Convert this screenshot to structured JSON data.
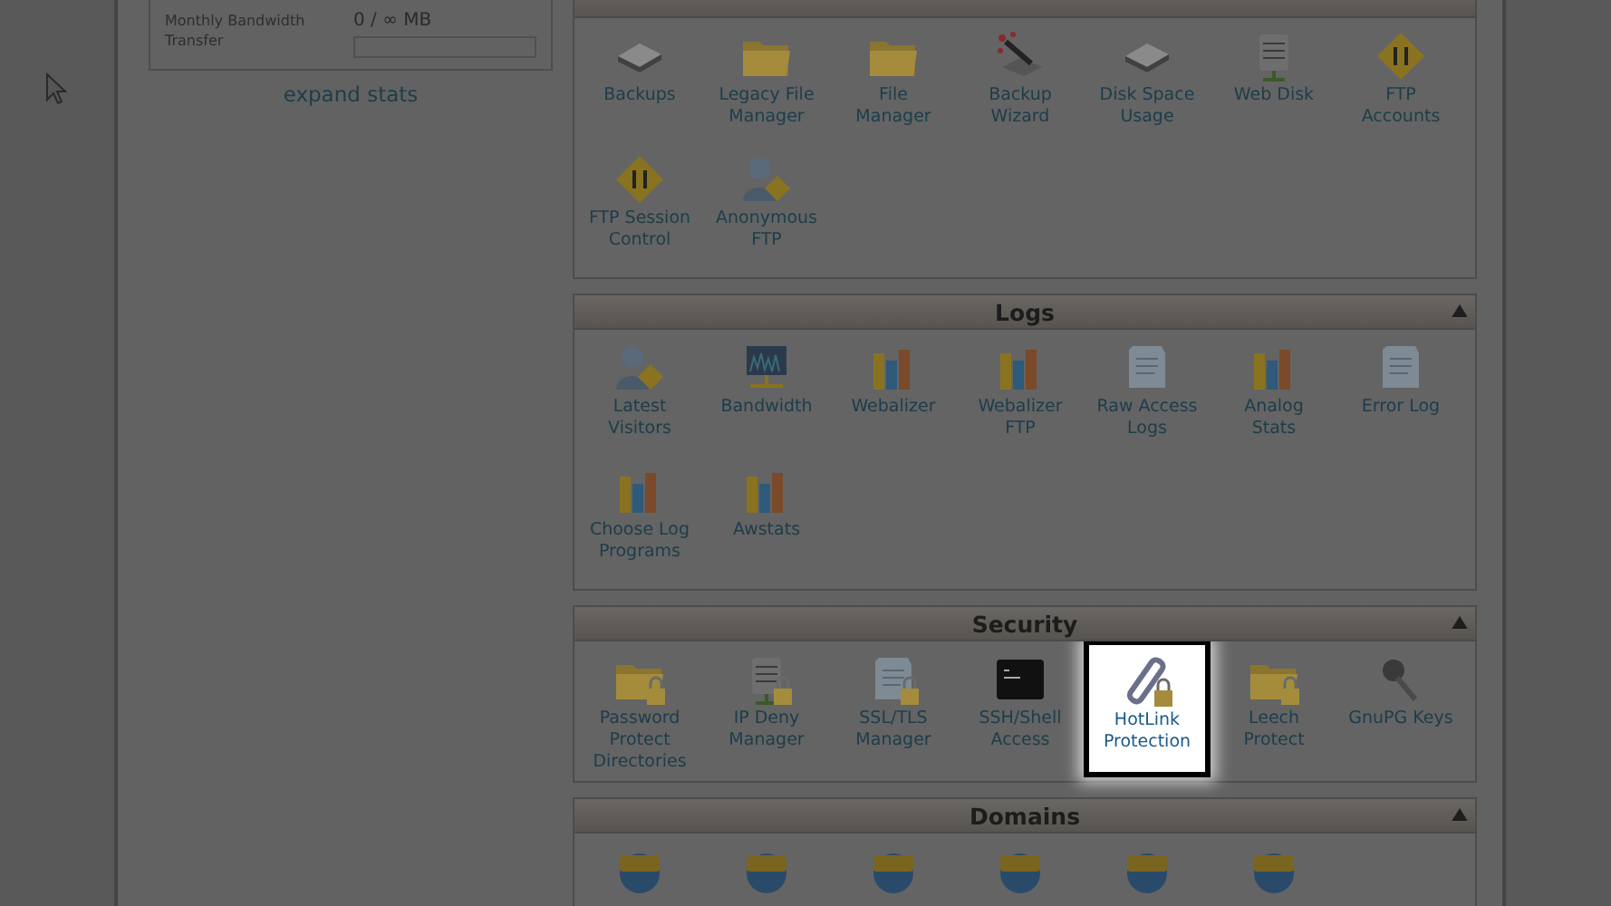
{
  "stats": {
    "label": "Monthly Bandwidth Transfer",
    "value": "0 / ∞ MB"
  },
  "expand_link": "expand stats",
  "sections": [
    {
      "items": [
        {
          "label": "Backups",
          "selected": false
        },
        {
          "label": "Legacy File Manager",
          "selected": false
        },
        {
          "label": "File Manager",
          "selected": false
        },
        {
          "label": "Backup Wizard",
          "selected": false
        },
        {
          "label": "Disk Space Usage",
          "selected": false
        },
        {
          "label": "Web Disk",
          "selected": false
        },
        {
          "label": "FTP Accounts",
          "selected": false
        },
        {
          "label": "FTP Session Control",
          "selected": false
        },
        {
          "label": "Anonymous FTP",
          "selected": false
        }
      ]
    },
    {
      "title": "Logs",
      "items": [
        {
          "label": "Latest Visitors",
          "selected": false
        },
        {
          "label": "Bandwidth",
          "selected": false
        },
        {
          "label": "Webalizer",
          "selected": false
        },
        {
          "label": "Webalizer FTP",
          "selected": false
        },
        {
          "label": "Raw Access Logs",
          "selected": false
        },
        {
          "label": "Analog Stats",
          "selected": false
        },
        {
          "label": "Error Log",
          "selected": false
        },
        {
          "label": "Choose Log Programs",
          "selected": false
        },
        {
          "label": "Awstats",
          "selected": false
        }
      ]
    },
    {
      "title": "Security",
      "items": [
        {
          "label": "Password Protect Directories",
          "selected": false
        },
        {
          "label": "IP Deny Manager",
          "selected": false
        },
        {
          "label": "SSL/TLS Manager",
          "selected": false
        },
        {
          "label": "SSH/Shell Access",
          "selected": false
        },
        {
          "label": "HotLink Protection",
          "selected": true
        },
        {
          "label": "Leech Protect",
          "selected": false
        },
        {
          "label": "GnuPG Keys",
          "selected": false
        }
      ]
    },
    {
      "title": "Domains"
    }
  ]
}
